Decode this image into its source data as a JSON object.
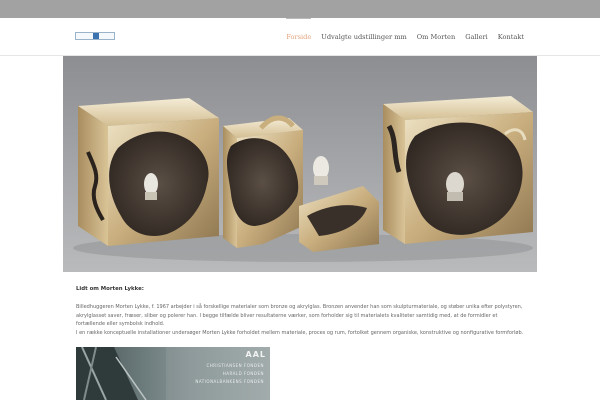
{
  "nav": {
    "items": [
      {
        "label": "Forside",
        "active": true
      },
      {
        "label": "Udvalgte udstillinger mm",
        "active": false
      },
      {
        "label": "Om Morten",
        "active": false
      },
      {
        "label": "Galleri",
        "active": false
      },
      {
        "label": "Kontakt",
        "active": false
      }
    ],
    "active_color": "#e3a27c"
  },
  "content": {
    "title": "Lidt om Morten Lykke:",
    "paragraph1": "Billedhuggeren Morten Lykke, f. 1967 arbejder i så forskellige materialer som bronze og akrylglas. Bronzen anvender han som skulpturmateriale, og støber unika efter polystyren, akrylglasset saver, fræser, sliber og polerer han. I begge tilfælde bliver resultaterne værker, som forholder sig til materialets kvaliteter samtidig med, at de formidler et fortællende eller symbolsk indhold.",
    "paragraph2": "I en række konceptuelle installationer undersøger Morten Lykke forholdet mellem materiale, proces og rum, fortolket gennem organiske, konstruktive og nonfigurative formforløb."
  },
  "photo": {
    "big_text": "AAL",
    "lines": [
      "CHRISTIANSEN FONDEN",
      "HARALD FONDEN",
      "NATIONALBANKENS FONDEN"
    ]
  }
}
